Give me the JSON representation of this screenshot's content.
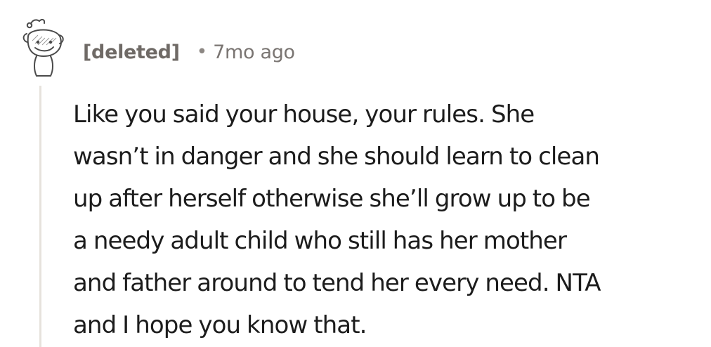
{
  "comment": {
    "author": "[deleted]",
    "separator": "•",
    "timestamp": "7mo ago",
    "avatar_icon": "deleted-user-snoo-icon",
    "body_lines": [
      "Like you said your house, your rules. She",
      "wasn’t in danger and she should learn to clean",
      "up after herself otherwise she’ll grow up to be",
      "a needy adult child who still has her mother",
      "and father around to tend her every need. NTA",
      "and I hope you know that."
    ]
  },
  "colors": {
    "author": "#6f6a66",
    "timestamp": "#7a7572",
    "body": "#1c1c1c",
    "thread_line": "#e6e2dc"
  }
}
